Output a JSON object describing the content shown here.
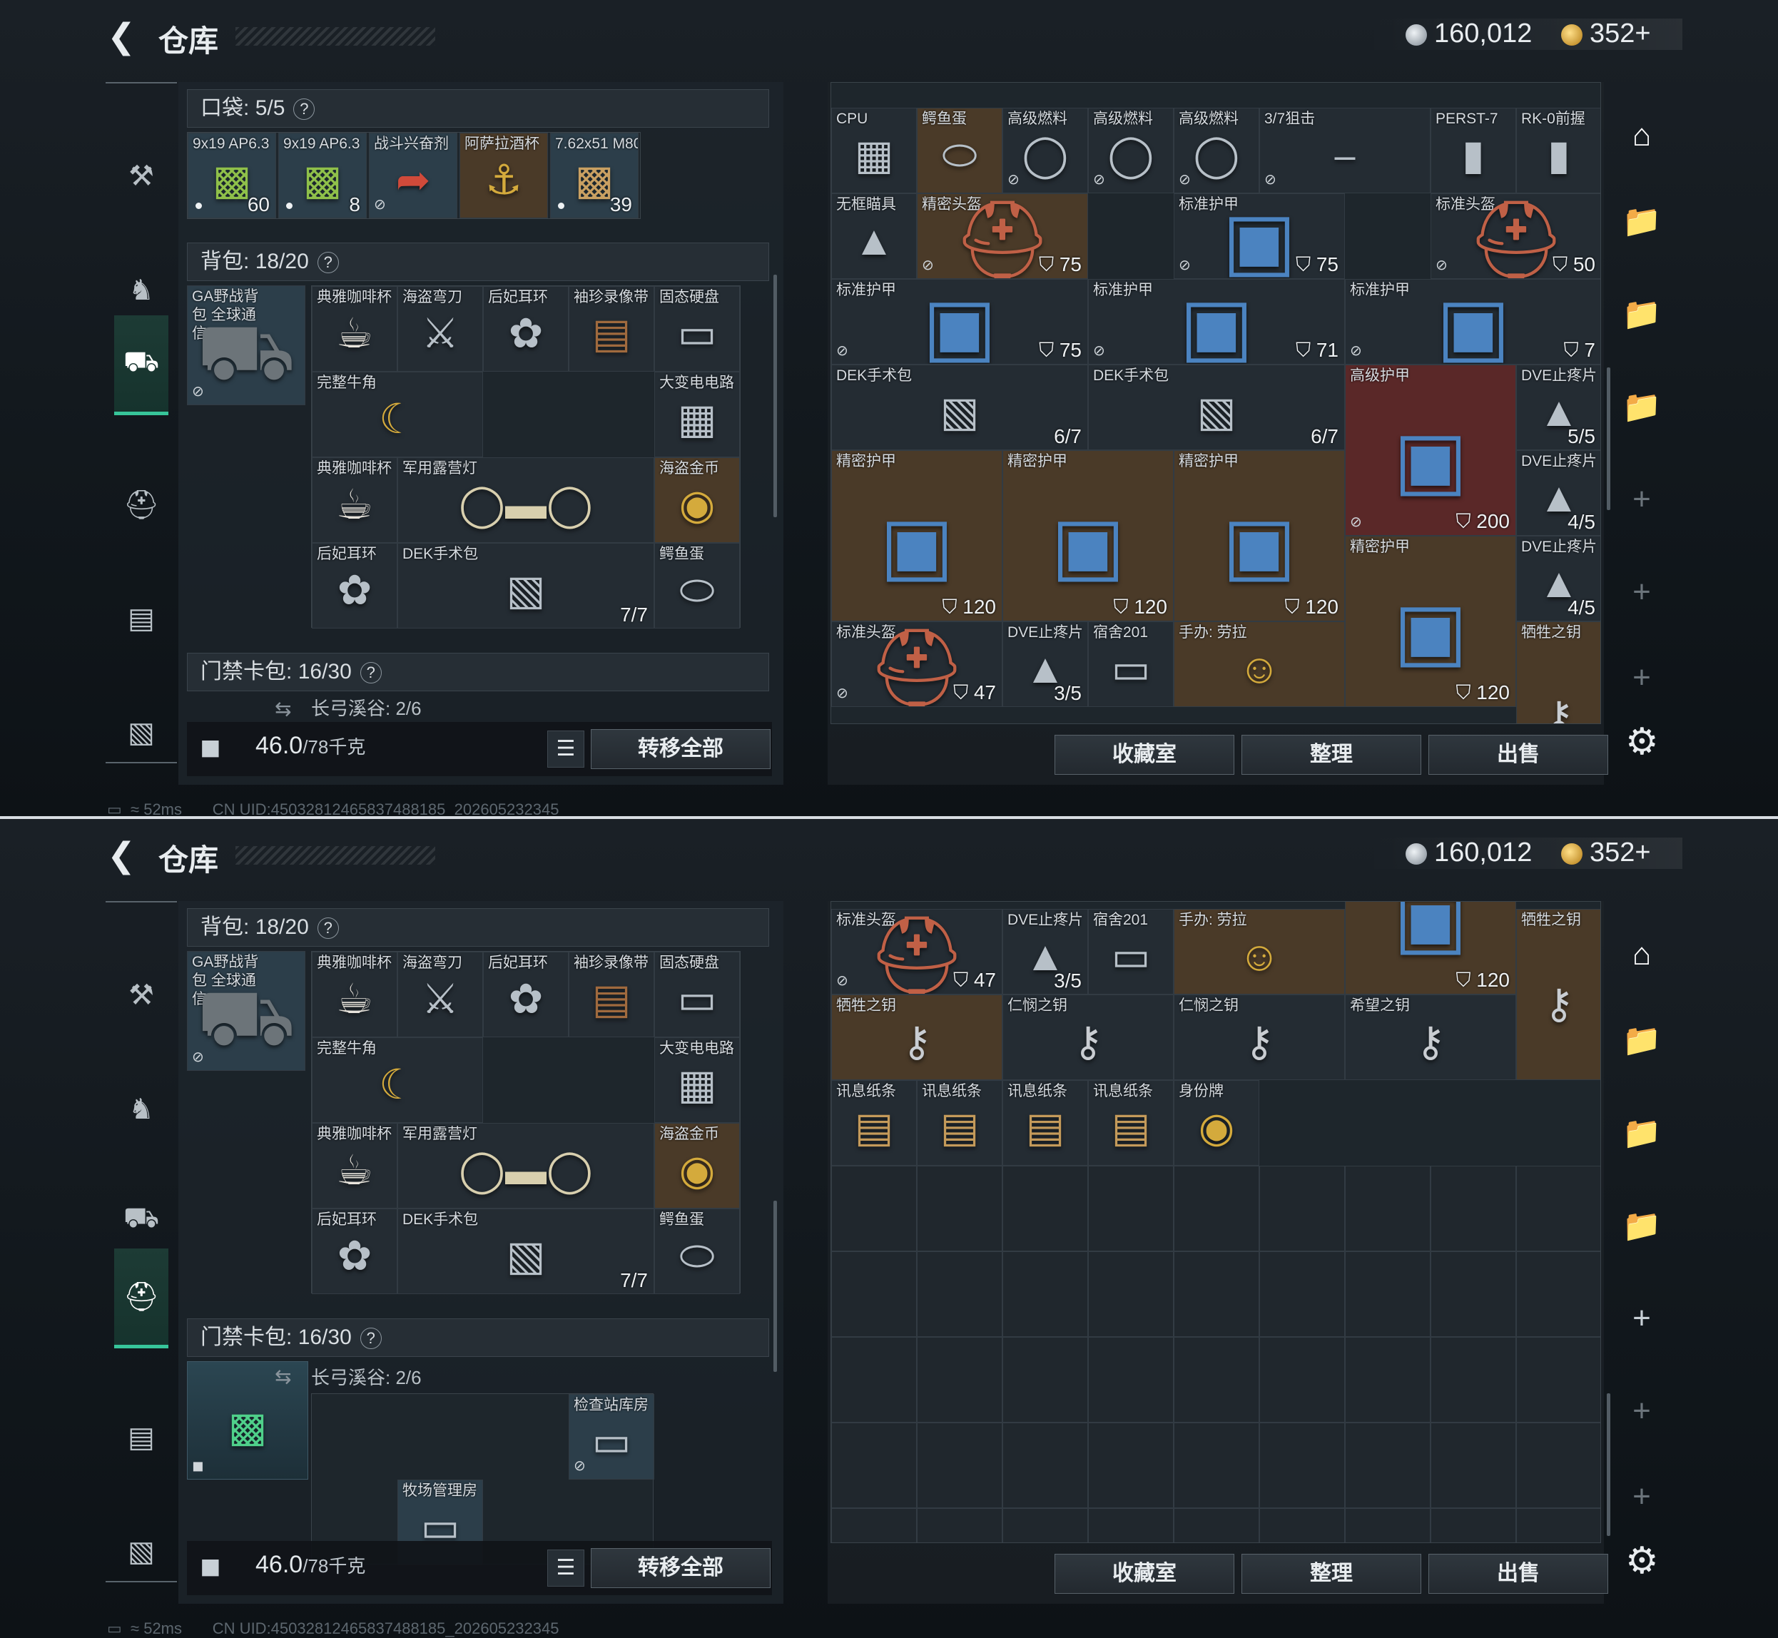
{
  "header": {
    "title": "仓库",
    "back_icon": "back-arrow-icon",
    "coin_silver": "160,012",
    "coin_gold": "352+"
  },
  "left_nav": [
    {
      "id": "weapons",
      "icon": "gun-icon"
    },
    {
      "id": "armor",
      "icon": "armor-icon"
    },
    {
      "id": "backpack",
      "icon": "backpack-icon"
    },
    {
      "id": "helmet",
      "icon": "helmet-icon"
    },
    {
      "id": "vest",
      "icon": "vest-icon"
    },
    {
      "id": "case",
      "icon": "briefcase-icon"
    }
  ],
  "pocket": {
    "label": "口袋:",
    "count": "5/5",
    "items": [
      {
        "name": "9x19 AP6.3",
        "qty": "60"
      },
      {
        "name": "9x19 AP6.3",
        "qty": "8"
      },
      {
        "name": "战斗兴奋剂",
        "qty": ""
      },
      {
        "name": "阿萨拉酒杯",
        "qty": ""
      },
      {
        "name": "7.62x51 M80",
        "qty": "39"
      }
    ]
  },
  "backpack": {
    "label": "背包:",
    "count": "18/20",
    "bag_name": "GA野战背包 全球通信",
    "items": [
      {
        "name": "典雅咖啡杯"
      },
      {
        "name": "海盗弯刀"
      },
      {
        "name": "后妃耳环"
      },
      {
        "name": "袖珍录像带"
      },
      {
        "name": "固态硬盘"
      },
      {
        "name": "完整牛角"
      },
      {
        "name": "大变电电路"
      },
      {
        "name": "典雅咖啡杯"
      },
      {
        "name": "军用露营灯"
      },
      {
        "name": "海盗金币"
      },
      {
        "name": "后妃耳环"
      },
      {
        "name": "DEK手术包",
        "qty": "7/7"
      },
      {
        "name": "鳄鱼蛋"
      }
    ]
  },
  "keycard": {
    "label": "门禁卡包:",
    "count": "16/30",
    "sub": "长弓溪谷: 2/6",
    "cards": [
      "检查站库房",
      "牧场管理房"
    ]
  },
  "weight": {
    "value": "46.0",
    "max": "/78千克"
  },
  "buttons": {
    "transfer_all": "转移全部",
    "collection": "收藏室",
    "sort": "整理",
    "sell": "出售"
  },
  "stash_top": [
    {
      "name": "CPU"
    },
    {
      "name": "鳄鱼蛋"
    },
    {
      "name": "高级燃料"
    },
    {
      "name": "高级燃料"
    },
    {
      "name": "高级燃料"
    },
    {
      "name": "3/7狙击"
    },
    {
      "name": "PERST-7"
    },
    {
      "name": "RK-0前握"
    },
    {
      "name": "无框瞄具"
    },
    {
      "name": "精密头盔",
      "dur": "75"
    },
    {
      "name": "标准护甲",
      "dur": "75"
    },
    {
      "name": "标准头盔",
      "dur": "50"
    },
    {
      "name": "标准护甲",
      "dur": "75"
    },
    {
      "name": "标准护甲",
      "dur": "71"
    },
    {
      "name": "标准护甲",
      "dur": "7"
    },
    {
      "name": "DEK手术包",
      "qty": "6/7"
    },
    {
      "name": "DEK手术包",
      "qty": "6/7"
    },
    {
      "name": "高级护甲",
      "dur": "200"
    },
    {
      "name": "DVE止疼片",
      "qty": "5/5"
    },
    {
      "name": "精密护甲",
      "dur": "120"
    },
    {
      "name": "精密护甲",
      "dur": "120"
    },
    {
      "name": "精密护甲",
      "dur": "120"
    },
    {
      "name": "DVE止疼片",
      "qty": "4/5"
    },
    {
      "name": "精密护甲",
      "dur": "120"
    },
    {
      "name": "DVE止疼片",
      "qty": "4/5"
    },
    {
      "name": "标准头盔",
      "dur": "47"
    },
    {
      "name": "DVE止疼片",
      "qty": "3/5"
    },
    {
      "name": "宿舍201"
    },
    {
      "name": "手办: 劳拉"
    },
    {
      "name": "牺牲之钥"
    },
    {
      "name": "牺牲之钥"
    },
    {
      "name": "仁悯之钥"
    },
    {
      "name": "仁悯之钥"
    },
    {
      "name": "希望之钥"
    }
  ],
  "stash_bottom_extra": [
    {
      "name": "讯息纸条"
    },
    {
      "name": "讯息纸条"
    },
    {
      "name": "讯息纸条"
    },
    {
      "name": "讯息纸条"
    },
    {
      "name": "身份牌"
    }
  ],
  "right_nav": [
    "home-icon",
    "folder-iv-icon",
    "folder-ii-icon",
    "folder-iii-icon",
    "add-icon",
    "add-icon",
    "add-icon"
  ],
  "status": {
    "ping": "52ms",
    "uid": "CN UID:45032812465837488185_202605232345"
  }
}
